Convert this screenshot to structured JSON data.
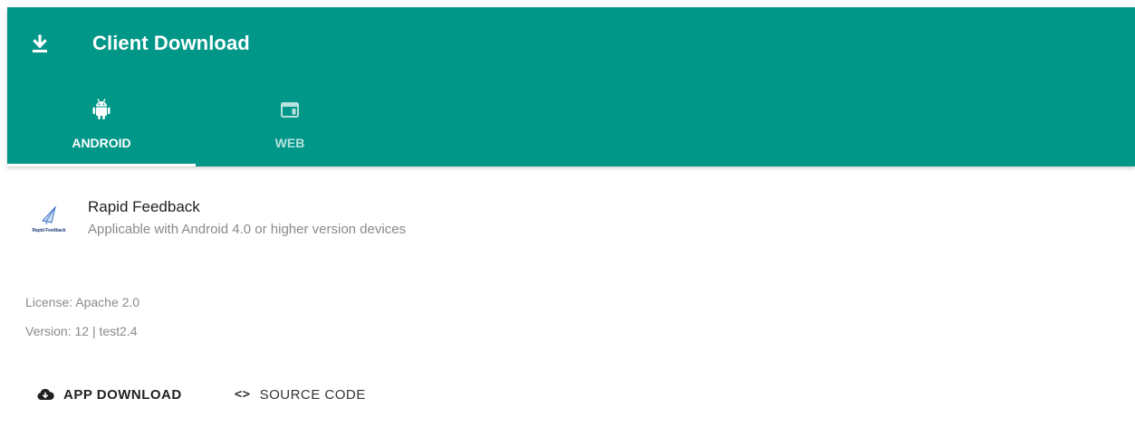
{
  "header": {
    "title": "Client Download",
    "icon": "download-icon",
    "background": "#009688"
  },
  "tabs": [
    {
      "label": "ANDROID",
      "icon": "android-icon",
      "active": true
    },
    {
      "label": "WEB",
      "icon": "web-window-icon",
      "active": false
    }
  ],
  "app": {
    "name": "Rapid Feedback",
    "description": "Applicable with Android 4.0 or higher version devices",
    "logo_caption": "Rapid Feedback",
    "logo_icon": "paper-plane-icon",
    "license": "License: Apache 2.0",
    "version": "Version: 12 | test2.4"
  },
  "actions": {
    "app_download": {
      "label": "APP DOWNLOAD",
      "icon": "cloud-download-icon"
    },
    "source_code": {
      "label": "SOURCE CODE",
      "icon_glyph": "<>",
      "icon": "code-icon"
    }
  }
}
